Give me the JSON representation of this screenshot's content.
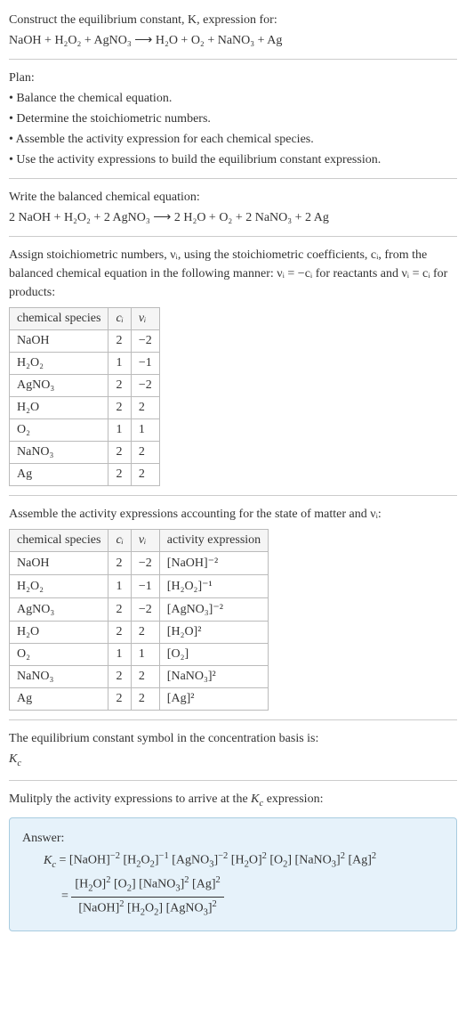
{
  "prompt": {
    "title": "Construct the equilibrium constant, K, expression for:",
    "equation": "NaOH + H₂O₂ + AgNO₃  ⟶  H₂O + O₂ + NaNO₃ + Ag"
  },
  "plan": {
    "heading": "Plan:",
    "items": [
      "• Balance the chemical equation.",
      "• Determine the stoichiometric numbers.",
      "• Assemble the activity expression for each chemical species.",
      "• Use the activity expressions to build the equilibrium constant expression."
    ]
  },
  "balanced": {
    "heading": "Write the balanced chemical equation:",
    "equation": "2 NaOH + H₂O₂ + 2 AgNO₃  ⟶  2 H₂O + O₂ + 2 NaNO₃ + 2 Ag"
  },
  "stoich": {
    "intro": "Assign stoichiometric numbers, νᵢ, using the stoichiometric coefficients, cᵢ, from the balanced chemical equation in the following manner: νᵢ = −cᵢ for reactants and νᵢ = cᵢ for products:",
    "headers": [
      "chemical species",
      "cᵢ",
      "νᵢ"
    ],
    "rows": [
      [
        "NaOH",
        "2",
        "−2"
      ],
      [
        "H₂O₂",
        "1",
        "−1"
      ],
      [
        "AgNO₃",
        "2",
        "−2"
      ],
      [
        "H₂O",
        "2",
        "2"
      ],
      [
        "O₂",
        "1",
        "1"
      ],
      [
        "NaNO₃",
        "2",
        "2"
      ],
      [
        "Ag",
        "2",
        "2"
      ]
    ]
  },
  "activity": {
    "intro": "Assemble the activity expressions accounting for the state of matter and νᵢ:",
    "headers": [
      "chemical species",
      "cᵢ",
      "νᵢ",
      "activity expression"
    ],
    "rows": [
      [
        "NaOH",
        "2",
        "−2",
        "[NaOH]⁻²"
      ],
      [
        "H₂O₂",
        "1",
        "−1",
        "[H₂O₂]⁻¹"
      ],
      [
        "AgNO₃",
        "2",
        "−2",
        "[AgNO₃]⁻²"
      ],
      [
        "H₂O",
        "2",
        "2",
        "[H₂O]²"
      ],
      [
        "O₂",
        "1",
        "1",
        "[O₂]"
      ],
      [
        "NaNO₃",
        "2",
        "2",
        "[NaNO₃]²"
      ],
      [
        "Ag",
        "2",
        "2",
        "[Ag]²"
      ]
    ]
  },
  "kcsymbol": {
    "line1": "The equilibrium constant symbol in the concentration basis is:",
    "line2": "K_c"
  },
  "multiply": {
    "heading": "Mulitply the activity expressions to arrive at the K_c expression:"
  },
  "answer": {
    "label": "Answer:",
    "line1": "K_c = [NaOH]⁻² [H₂O₂]⁻¹ [AgNO₃]⁻² [H₂O]² [O₂] [NaNO₃]² [Ag]²",
    "frac_num": "[H₂O]² [O₂] [NaNO₃]² [Ag]²",
    "frac_den": "[NaOH]² [H₂O₂] [AgNO₃]²",
    "eq_prefix": "= "
  }
}
